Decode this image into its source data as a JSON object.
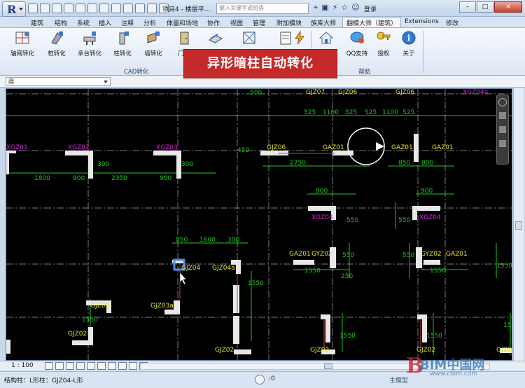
{
  "titlebar": {
    "title": "项目4 - 楼层平...",
    "search_placeholder": "键入关键字或短语",
    "login": "登录",
    "app_letter": "R"
  },
  "tabs": [
    "建筑",
    "结构",
    "系统",
    "插入",
    "注释",
    "分析",
    "体量和场地",
    "协作",
    "视图",
    "管理",
    "附加模块",
    "族库大师",
    "翻模大师（建筑）",
    "Extensions",
    "修改"
  ],
  "ribbon": {
    "cad_buttons": [
      "轴网转化",
      "桩转化",
      "承台转化",
      "柱转化",
      "墙转化",
      "门窗"
    ],
    "cad_group_label": "CAD转化",
    "help_buttons": [
      "QQ支持",
      "授权",
      "关于"
    ],
    "help_group_label": "帮助"
  },
  "banner": "异形暗柱自动转化",
  "properties": {
    "selector": "阕"
  },
  "drawing": {
    "col_labels_magenta": [
      "XGZ01",
      "XGZ02",
      "XGZ03",
      "XGZ04",
      "XGZ04",
      "XGZ04a"
    ],
    "col_labels_yellow": [
      "GJZ07",
      "GJZ06",
      "GJZ06",
      "GJZ06",
      "GAZ01",
      "GAZ01",
      "GAZ01",
      "GYZ02",
      "GYZ02",
      "GJZ04",
      "GJZ04a",
      "GJZ03",
      "GJZ03a",
      "GJZ02",
      "GJZ02",
      "GJZ02",
      "GJZ02",
      "GAZ01",
      "GAZ01",
      "GJZ02"
    ],
    "dims": [
      "525",
      "1100",
      "525",
      "525",
      "1100",
      "525",
      "1800",
      "900",
      "300",
      "2350",
      "900",
      "300",
      "2750",
      "450",
      "850",
      "800",
      "900",
      "900",
      "550",
      "550",
      "850",
      "1600",
      "300",
      "1550",
      "250",
      "1550",
      "550",
      "550",
      "1550",
      "1550",
      "1550",
      "1550",
      "1550",
      "500",
      "1550"
    ]
  },
  "viewbar": {
    "scale": "1 : 100"
  },
  "statusbar": {
    "text": "结构柱：L形柱：GJZ04-L形",
    "zero": ":0",
    "model": "主模型"
  },
  "watermark": {
    "brand": "BIM中国网",
    "url": "www.cbim.com"
  },
  "colors": {
    "canvas": "#000000",
    "axis": "#7c7c7c",
    "dim": "#22c322",
    "label_yellow": "#e8e820",
    "label_magenta": "#e020e0",
    "column": "#e8e8e8",
    "banner": "#c52a2a"
  }
}
